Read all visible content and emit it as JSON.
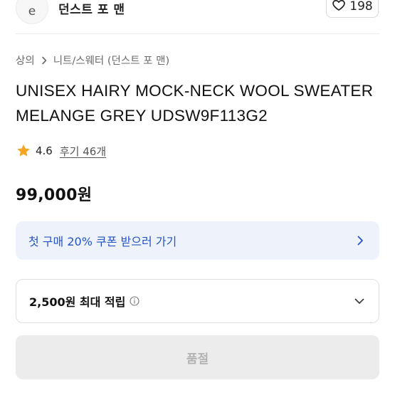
{
  "header": {
    "brand_icon": "brand-logo",
    "brand_name": "던스트 포 맨",
    "like_icon": "heart-outline-icon",
    "like_count": "198"
  },
  "breadcrumb": {
    "items": [
      "상의",
      "니트/스웨터 (던스트 포 맨)"
    ],
    "separator_icon": "chevron-right-icon"
  },
  "product": {
    "title": "UNISEX HAIRY MOCK-NECK WOOL SWEATER MELANGE GREY UDSW9F113G2",
    "rating": "4.6",
    "rating_icon": "star-icon",
    "reviews_label": "후기 46개",
    "price": "99,000원"
  },
  "coupon": {
    "label": "첫 구매 20% 쿠폰 받으러 가기",
    "icon": "chevron-right-icon",
    "text_color": "#2553c6",
    "bg_color": "#eef3fb"
  },
  "points": {
    "label": "2,500원 최대 적립",
    "info_icon": "info-icon",
    "expand_icon": "chevron-down-icon"
  },
  "purchase": {
    "soldout_label": "품절"
  },
  "colors": {
    "star": "#f5a623",
    "accent": "#2553c6"
  }
}
